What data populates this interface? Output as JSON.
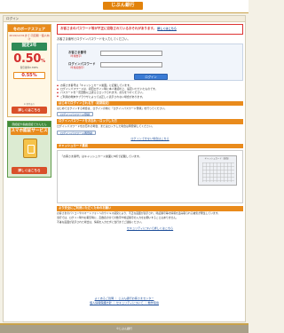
{
  "header": {
    "brand": "じぶん銀行"
  },
  "page": {
    "title": "ログイン"
  },
  "banner1": {
    "heading": "冬のボーナスフェア",
    "sub": "2019/12/31まで 円定期・個人向け",
    "plan": "固定2年",
    "rate": "0.50",
    "rate_unit": "%",
    "note": "税引後年0.398%",
    "rate2": "0.55%",
    "foot": "※ 条件あり",
    "button": "詳しくはこちら"
  },
  "banner2": {
    "top": "顔認証や指紋認証でかんたん",
    "title": "スマホ認証サービス",
    "button": "詳しくはこちら"
  },
  "alert": {
    "line1": "お客さまのパスワード等が不正に窃取されているおそれがあります。",
    "link": "詳しくはこちら"
  },
  "login": {
    "intro": "お客さま番号とログインパスワードを入力してください。",
    "customer_label": "お客さま番号",
    "customer_hint": "（半角数字）",
    "customer_placeholder": "",
    "password_label": "ログインパスワード",
    "password_hint": "（半角英数字）",
    "password_placeholder": "",
    "button": "ログイン"
  },
  "notes": [
    "お客さま番号は「キャッシュカード裏面」に記載しています。",
    "ログインパスワードは、初回ログイン時に本人確認の上、設定いただいたものです。",
    "パスワードを一定回数以上誤るとロックされます。お気をつけください。",
    "ご利用の端末やブラウザによっては正しく表示されない場合があります。"
  ],
  "first_time": {
    "title": "はじめてログインされる方（初期設定）",
    "body": "はじめてログインする場合は、ログインの前に「ログインパスワード登録」を行ってください。",
    "button": "ログインパスワード登録"
  },
  "unlock": {
    "title": "ログインパスワードをお忘れ・ロックした方",
    "body": "ログインパスワードをお忘れの場合、またはロックした場合は再登録してください。",
    "button": "ログインパスワード再登録",
    "link": "ログインできない場合はこちら"
  },
  "card": {
    "title": "キャッシュカード裏面",
    "body": "「お客さま番号」はキャッシュカード裏面に8桁で記載しています。",
    "caption": "キャッシュカード（裏面）"
  },
  "faq": {
    "title": "より安全にご利用いただくためのお願い",
    "p1": "お客さまのパソコンやスマートフォンへのウイルス感染により、不正な画面が表示され、暗証番号等の情報を盗み取られる被害が発生しています。",
    "p2": "当行では、ログイン時やお取引時に、乱数表の全ての数字や暗証番号の入力をお願いすることはありません。",
    "p3": "不審な画面が表示された場合は、情報を入力せずに当行までご連絡ください。",
    "link": "セキュリティについて詳しくはこちら"
  },
  "footer_links": {
    "row1": "よくあるご質問 ｜ じぶん銀行お客さまセンター",
    "row2": "個人情報保護方針 ｜ セキュリティについて ｜ 動作環境"
  },
  "footer": {
    "copyright": "©じぶん銀行"
  }
}
